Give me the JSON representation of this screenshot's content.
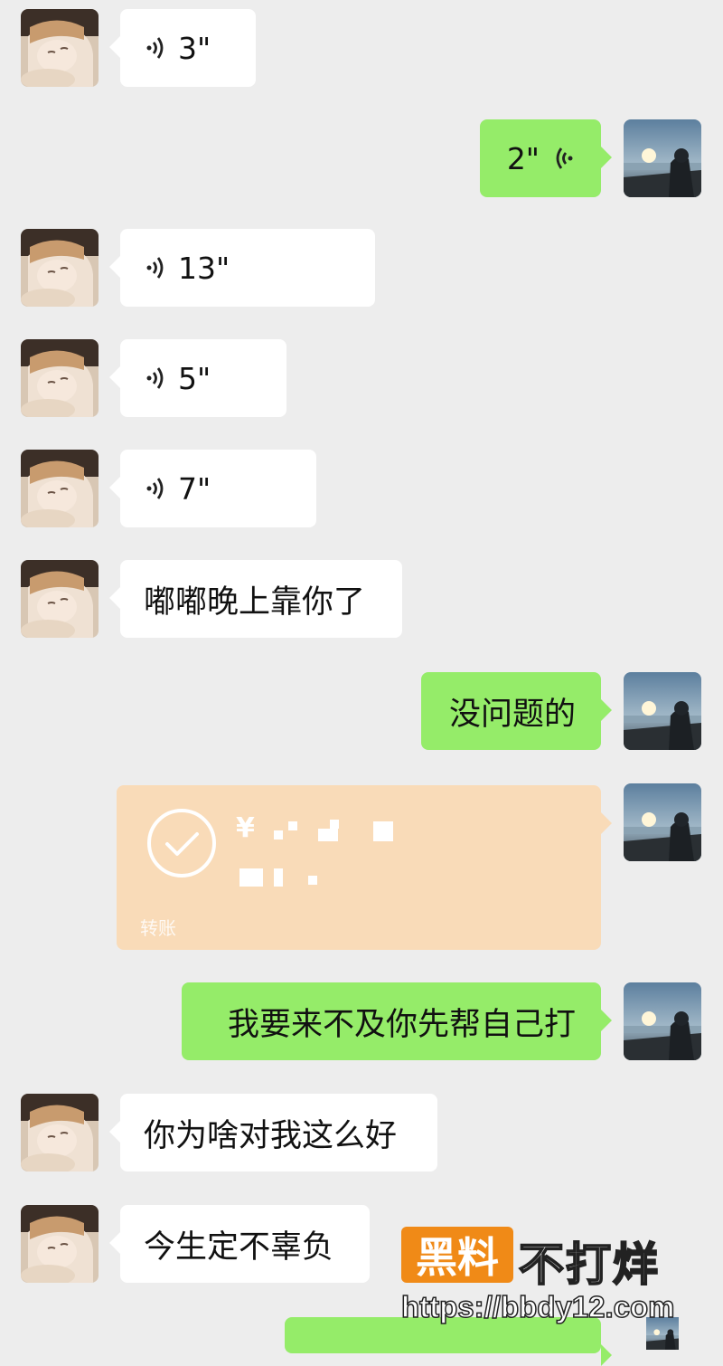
{
  "messages": [
    {
      "type": "voice",
      "side": "in",
      "duration": "3\""
    },
    {
      "type": "voice",
      "side": "out",
      "duration": "2\""
    },
    {
      "type": "voice",
      "side": "in",
      "duration": "13\""
    },
    {
      "type": "voice",
      "side": "in",
      "duration": "5\""
    },
    {
      "type": "voice",
      "side": "in",
      "duration": "7\""
    },
    {
      "type": "text",
      "side": "in",
      "text": "嘟嘟晚上靠你了"
    },
    {
      "type": "text",
      "side": "out",
      "text": "没问题的"
    },
    {
      "type": "transfer",
      "side": "out",
      "amount_prefix": "¥",
      "label": "转账",
      "status_icon": "check-circle-icon"
    },
    {
      "type": "text",
      "side": "out",
      "text": "我要来不及你先帮自己打"
    },
    {
      "type": "text",
      "side": "in",
      "text": "你为啥对我这么好"
    },
    {
      "type": "text",
      "side": "in",
      "text": "今生定不辜负"
    },
    {
      "type": "text",
      "side": "out",
      "text": ""
    }
  ],
  "watermark": {
    "brand_box": "黑料",
    "brand_rest": "不打烊",
    "url": "https://bbdy12.com"
  },
  "colors": {
    "background": "#ededed",
    "incoming_bubble": "#ffffff",
    "outgoing_bubble": "#95ec69",
    "transfer_card": "#f9dbb8",
    "watermark_accent": "#f08a17"
  }
}
